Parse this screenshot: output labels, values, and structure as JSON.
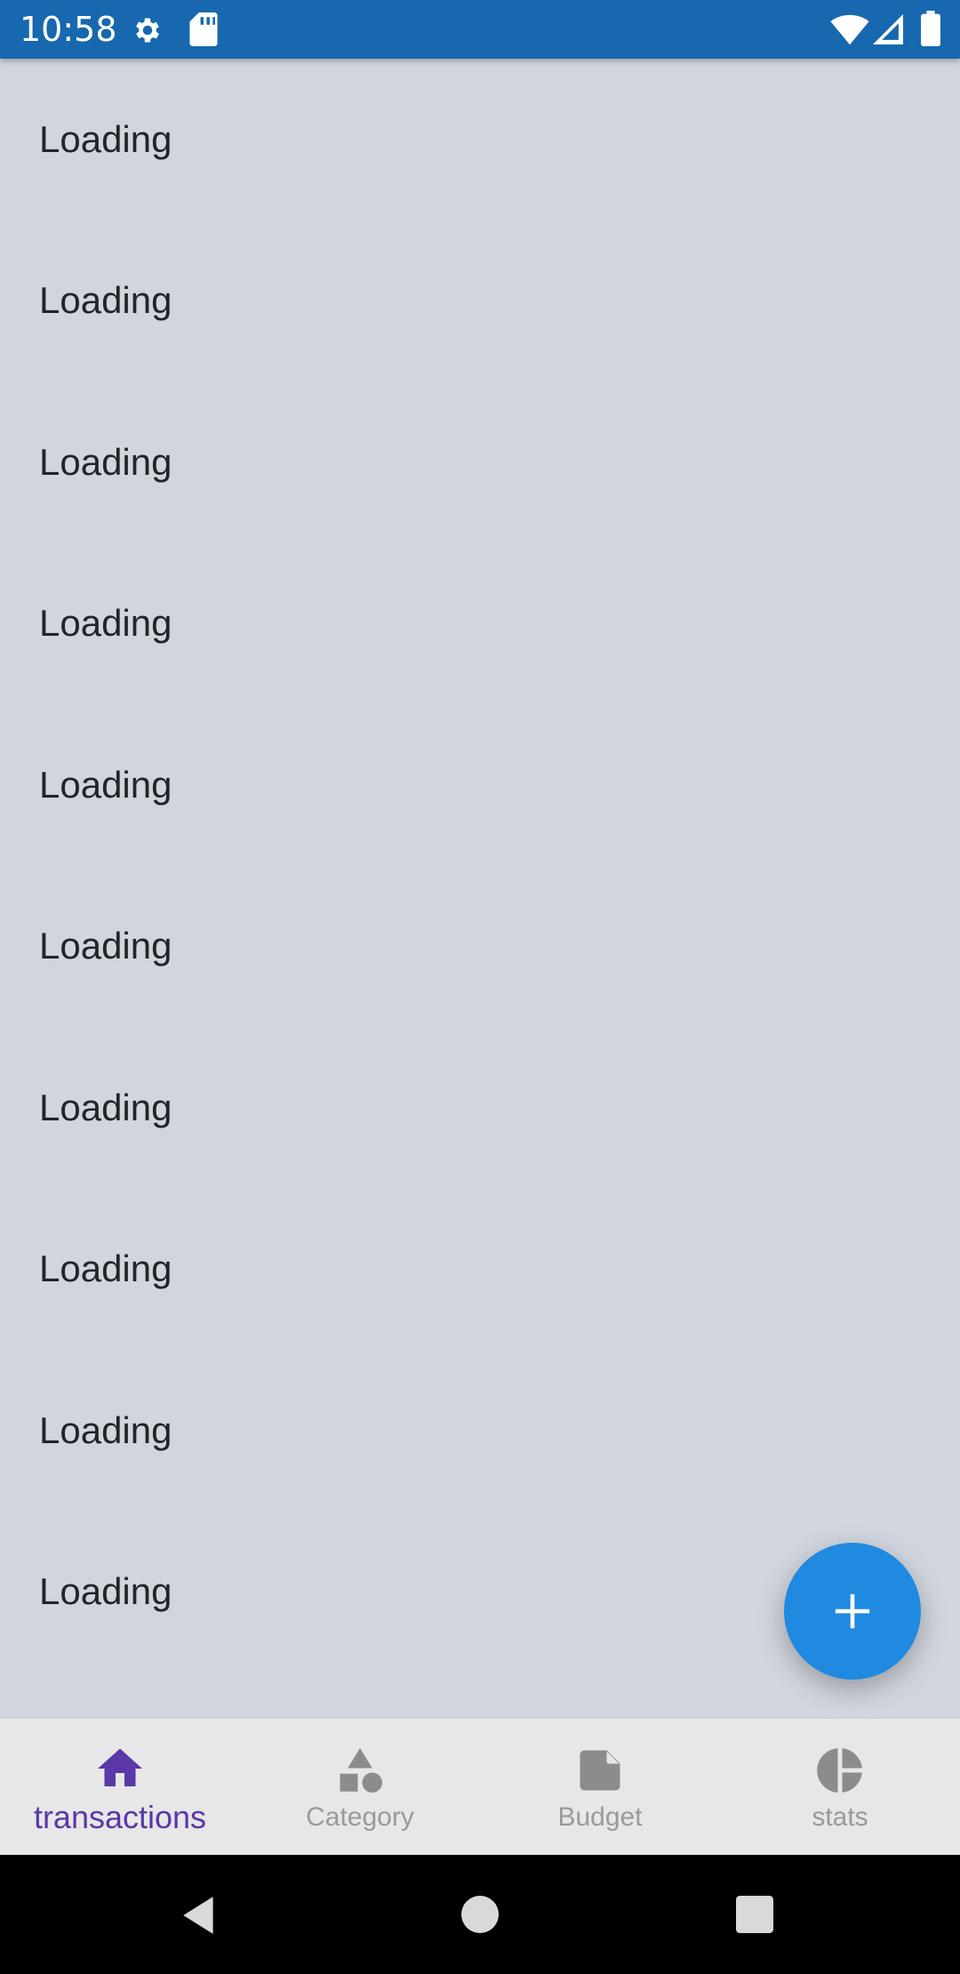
{
  "status_bar": {
    "time": "10:58",
    "icons": [
      "settings-icon",
      "sd-card-icon",
      "wifi-icon",
      "cell-signal-icon",
      "battery-icon"
    ],
    "background": "#1768ae"
  },
  "list": {
    "items": [
      "Loading",
      "Loading",
      "Loading",
      "Loading",
      "Loading",
      "Loading",
      "Loading",
      "Loading",
      "Loading",
      "Loading"
    ]
  },
  "fab": {
    "icon": "plus-icon",
    "color": "#2089e0"
  },
  "bottom_nav": {
    "items": [
      {
        "label": "transactions",
        "icon": "home-icon",
        "active": true
      },
      {
        "label": "Category",
        "icon": "category-shapes-icon",
        "active": false
      },
      {
        "label": "Budget",
        "icon": "budget-note-icon",
        "active": false
      },
      {
        "label": "stats",
        "icon": "pie-chart-icon",
        "active": false
      }
    ],
    "active_color": "#5b37a8",
    "inactive_color": "#9a9a9a"
  },
  "system_nav": {
    "icons": [
      "back-icon",
      "home-circle-icon",
      "recents-icon"
    ]
  }
}
